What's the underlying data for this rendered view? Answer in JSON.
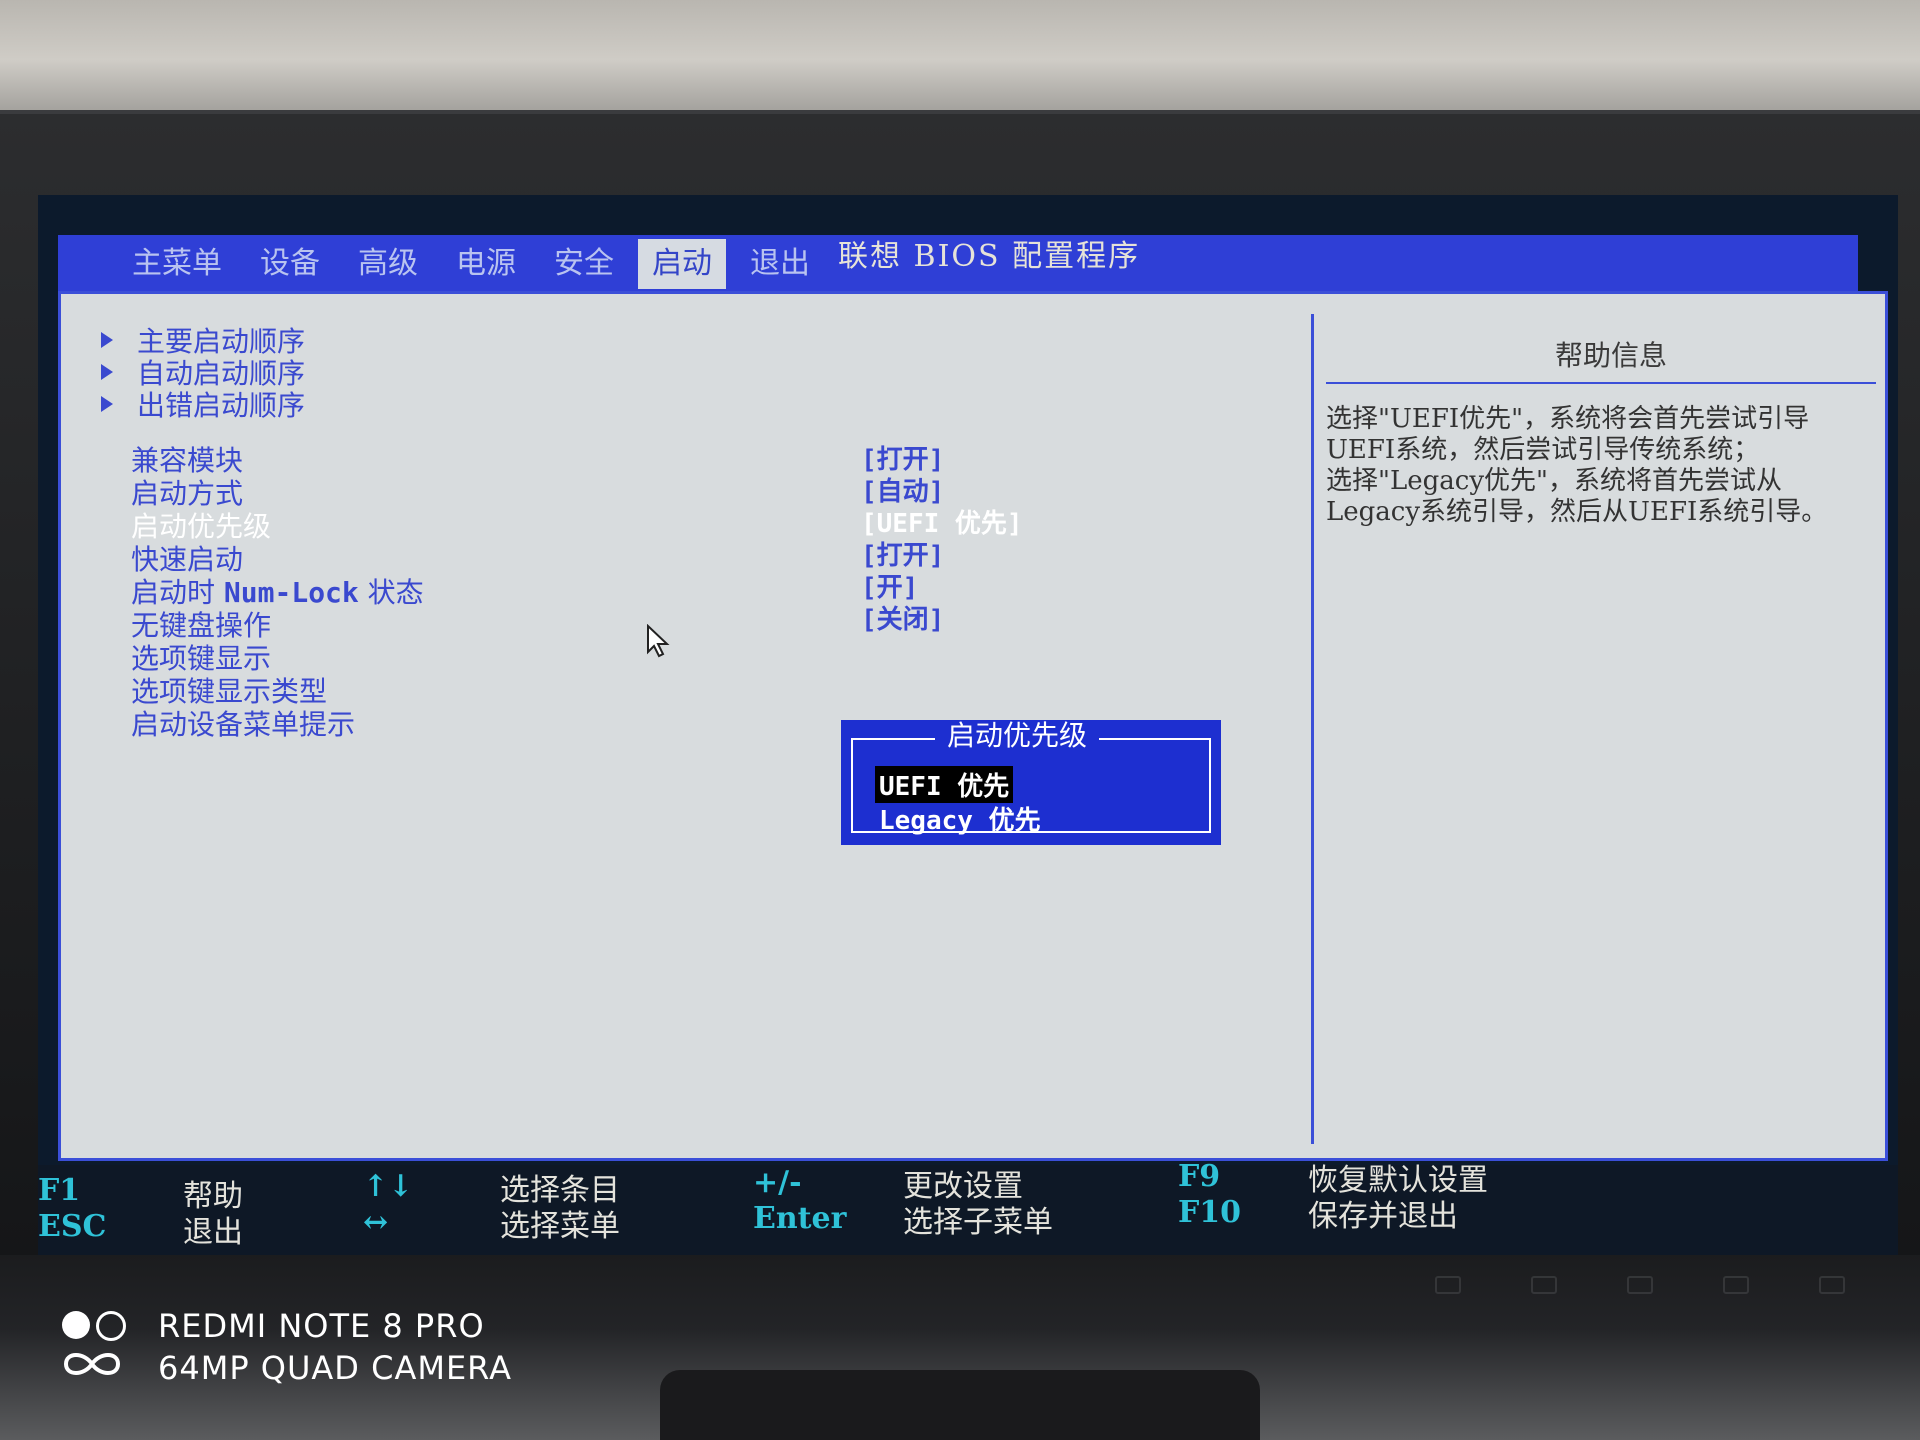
{
  "bios": {
    "title": "联想 BIOS 配置程序",
    "tabs": [
      {
        "label": "主菜单"
      },
      {
        "label": "设备"
      },
      {
        "label": "高级"
      },
      {
        "label": "电源"
      },
      {
        "label": "安全"
      },
      {
        "label": "启动"
      },
      {
        "label": "退出"
      }
    ],
    "active_tab": "启动",
    "submenus": [
      {
        "label": "主要启动顺序"
      },
      {
        "label": "自动启动顺序"
      },
      {
        "label": "出错启动顺序"
      }
    ],
    "settings": [
      {
        "label": "兼容模块",
        "value": "[打开]"
      },
      {
        "label": "启动方式",
        "value": "[自动]"
      },
      {
        "label": "启动优先级",
        "value": "[UEFI 优先]"
      },
      {
        "label": "快速启动",
        "value": "[打开]"
      },
      {
        "label_prefix": "启动时 ",
        "label_key": "Num-Lock",
        "label_suffix": " 状态",
        "value": "[开]"
      },
      {
        "label": "无键盘操作",
        "value": "[关闭]"
      },
      {
        "label": "选项键显示"
      },
      {
        "label": "选项键显示类型"
      },
      {
        "label": "启动设备菜单提示"
      }
    ],
    "help": {
      "title": "帮助信息",
      "text": "选择\"UEFI优先\"，系统将会首先尝试引导UEFI系统，然后尝试引导传统系统；\n选择\"Legacy优先\"，系统将首先尝试从Legacy系统引导，然后从UEFI系统引导。"
    },
    "popup": {
      "title": "启动优先级",
      "options": [
        "UEFI 优先",
        "Legacy 优先"
      ],
      "selected": "UEFI 优先"
    },
    "legend": [
      {
        "key": "F1",
        "desc": "帮助"
      },
      {
        "key": "ESC",
        "desc": "退出"
      },
      {
        "key": "↑↓",
        "desc": "选择条目"
      },
      {
        "key": "↔",
        "desc": "选择菜单"
      },
      {
        "key": "+/-",
        "desc": "更改设置"
      },
      {
        "key": "Enter",
        "desc": "选择子菜单"
      },
      {
        "key": "F9",
        "desc": "恢复默认设置"
      },
      {
        "key": "F10",
        "desc": "保存并退出"
      }
    ]
  },
  "watermark": {
    "line1": "REDMI NOTE 8 PRO",
    "line2": "64MP QUAD CAMERA"
  },
  "colors": {
    "menu_bar": "#2f3fd6",
    "panel_bg": "#d8dcde",
    "text_blue": "#3a49cf",
    "popup_bg": "#1d2fd0",
    "legend_key": "#2fc2d8"
  }
}
